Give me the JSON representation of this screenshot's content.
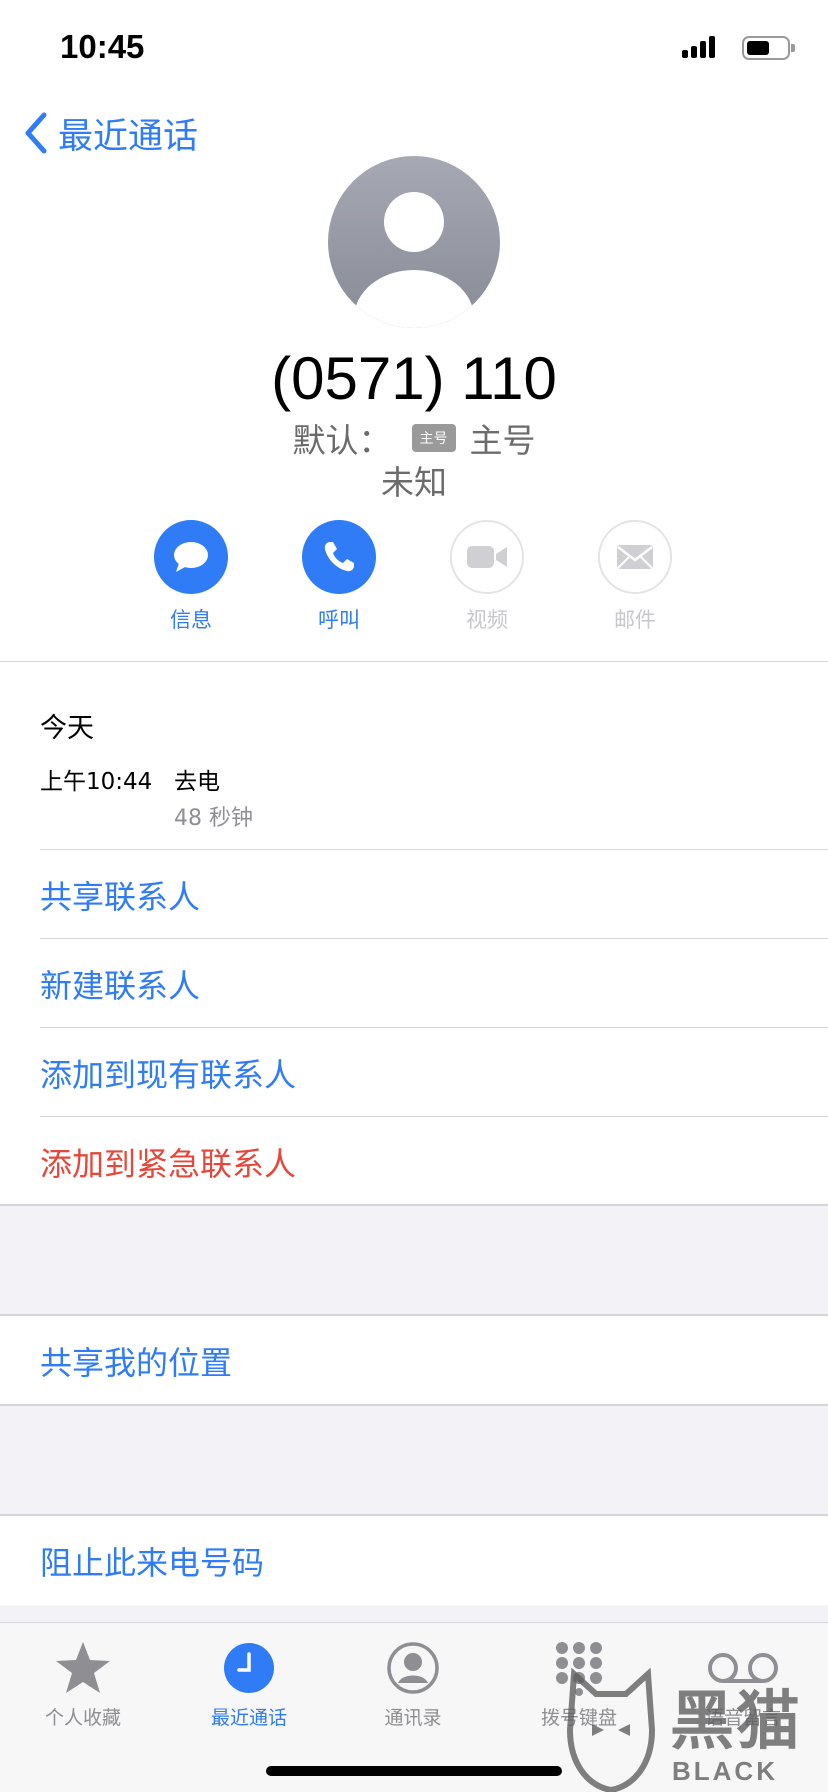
{
  "status_bar": {
    "time": "10:45"
  },
  "nav": {
    "back_label": "最近通话"
  },
  "contact": {
    "number": "(0571) 110",
    "default_label": "默认：",
    "sim_badge": "主号",
    "sim_name": "主号",
    "location": "未知"
  },
  "actions": [
    {
      "label": "信息",
      "icon": "message-icon",
      "enabled": true
    },
    {
      "label": "呼叫",
      "icon": "phone-icon",
      "enabled": true
    },
    {
      "label": "视频",
      "icon": "video-icon",
      "enabled": false
    },
    {
      "label": "邮件",
      "icon": "mail-icon",
      "enabled": false
    }
  ],
  "recents": {
    "day": "今天",
    "time": "上午10:44",
    "type": "去电",
    "duration": "48 秒钟"
  },
  "contact_actions": [
    {
      "label": "共享联系人"
    },
    {
      "label": "新建联系人"
    },
    {
      "label": "添加到现有联系人"
    },
    {
      "label": "添加到紧急联系人"
    }
  ],
  "location_action": {
    "label": "共享我的位置"
  },
  "block_action": {
    "label": "阻止此来电号码"
  },
  "tabs": [
    {
      "label": "个人收藏",
      "icon": "star-icon"
    },
    {
      "label": "最近通话",
      "icon": "clock-icon",
      "active": true
    },
    {
      "label": "通讯录",
      "icon": "contacts-icon"
    },
    {
      "label": "拨号键盘",
      "icon": "keypad-icon"
    },
    {
      "label": "语音留言",
      "icon": "voicemail-icon"
    }
  ],
  "watermark": {
    "text": "黑猫",
    "subtext": "BLACK CAT"
  },
  "colors": {
    "accent": "#2f7cf6",
    "danger": "#e6473a",
    "secondary": "#8e8e93"
  }
}
